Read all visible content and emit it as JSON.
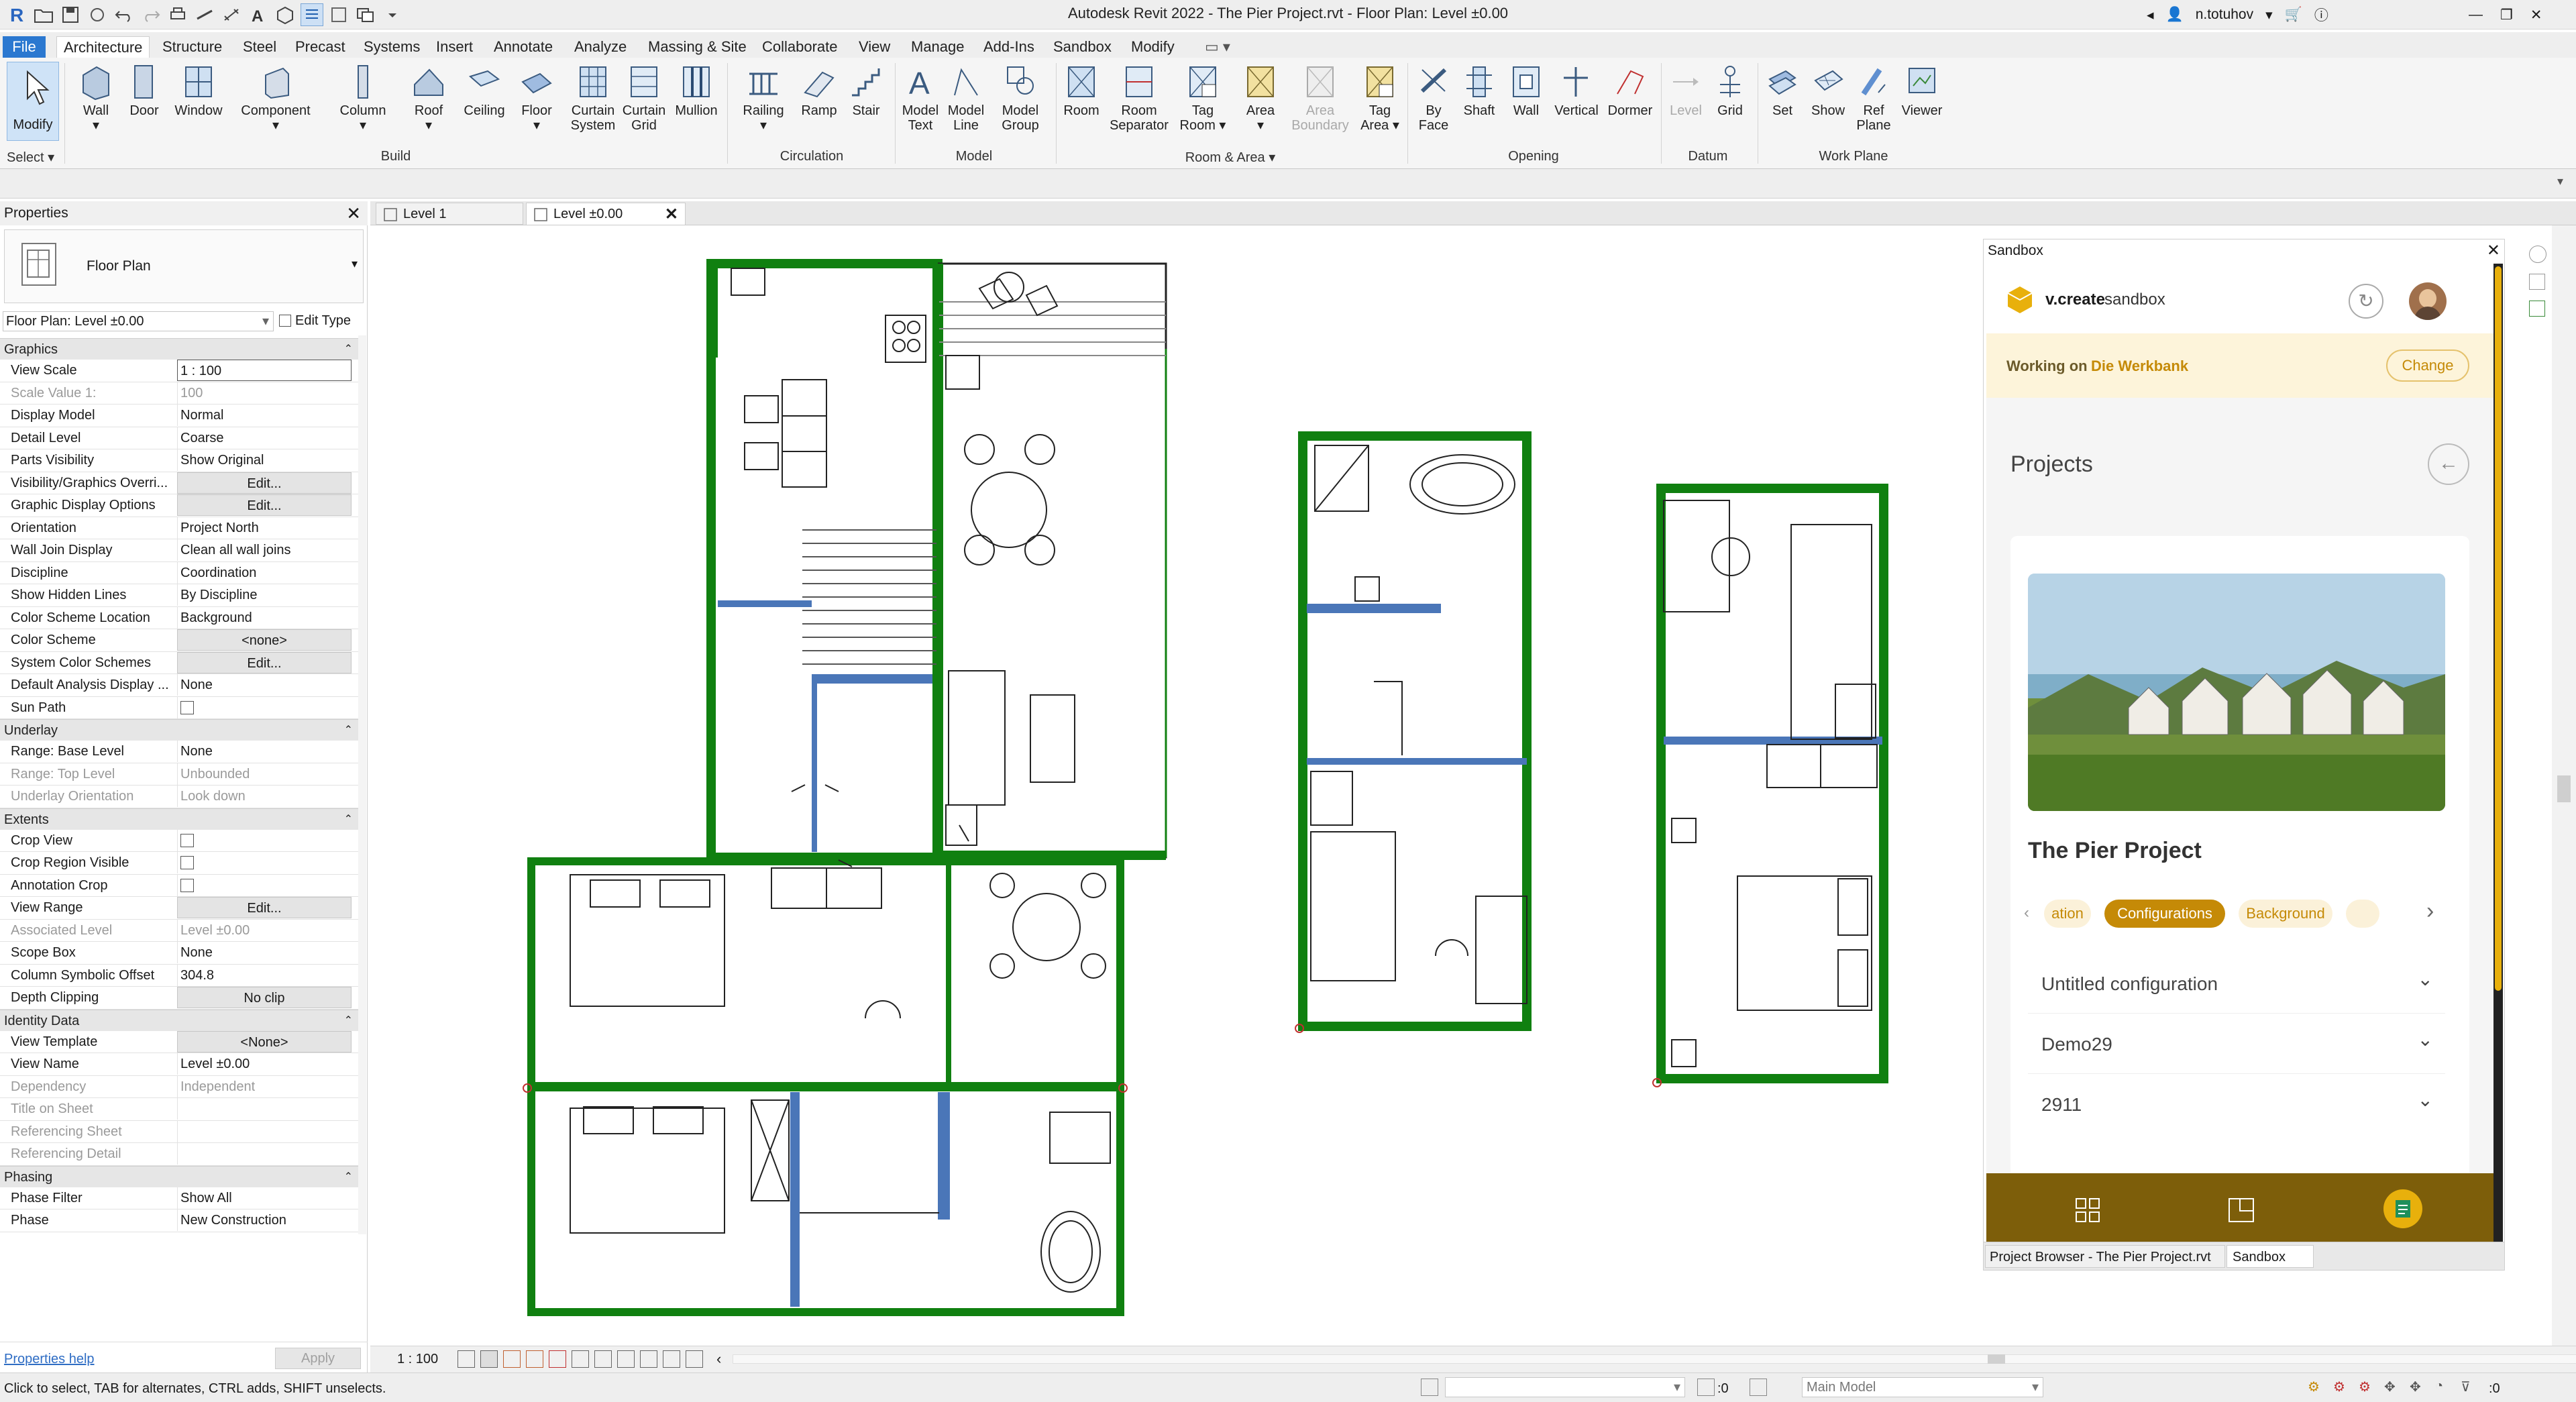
{
  "window": {
    "title": "Autodesk Revit 2022 - The Pier Project.rvt - Floor Plan: Level ±0.00",
    "user": "n.totuhov"
  },
  "menu": {
    "tabs": [
      "File",
      "Architecture",
      "Structure",
      "Steel",
      "Precast",
      "Systems",
      "Insert",
      "Annotate",
      "Analyze",
      "Massing & Site",
      "Collaborate",
      "View",
      "Manage",
      "Add-Ins",
      "Sandbox",
      "Modify"
    ],
    "active": "Architecture"
  },
  "ribbon": {
    "modify": "Modify",
    "select": "Select",
    "build": {
      "label": "Build",
      "wall": "Wall",
      "door": "Door",
      "window": "Window",
      "component": "Component",
      "column": "Column",
      "roof": "Roof",
      "ceiling": "Ceiling",
      "floor": "Floor",
      "curtain_system_1": "Curtain",
      "curtain_system_2": "System",
      "curtain_grid_1": "Curtain",
      "curtain_grid_2": "Grid",
      "mullion": "Mullion"
    },
    "circulation": {
      "label": "Circulation",
      "railing": "Railing",
      "ramp": "Ramp",
      "stair": "Stair"
    },
    "model": {
      "label": "Model",
      "model_text_1": "Model",
      "model_text_2": "Text",
      "model_line_1": "Model",
      "model_line_2": "Line",
      "model_group_1": "Model",
      "model_group_2": "Group"
    },
    "room_area": {
      "label": "Room & Area",
      "room": "Room",
      "room_sep_1": "Room",
      "room_sep_2": "Separator",
      "tag_room_1": "Tag",
      "tag_room_2": "Room",
      "area": "Area",
      "area_boundary_1": "Area",
      "area_boundary_2": "Boundary",
      "tag_area_1": "Tag",
      "tag_area_2": "Area"
    },
    "opening": {
      "label": "Opening",
      "by_face_1": "By",
      "by_face_2": "Face",
      "shaft": "Shaft",
      "wall": "Wall",
      "vertical": "Vertical",
      "dormer": "Dormer"
    },
    "datum": {
      "label": "Datum",
      "level": "Level",
      "grid": "Grid"
    },
    "work_plane": {
      "label": "Work Plane",
      "set": "Set",
      "show": "Show",
      "ref_plane_1": "Ref",
      "ref_plane_2": "Plane",
      "viewer": "Viewer"
    }
  },
  "properties": {
    "title": "Properties",
    "type_name": "Floor Plan",
    "instance": "Floor Plan: Level ±0.00",
    "edit_type": "Edit Type",
    "groups": {
      "graphics": "Graphics",
      "underlay": "Underlay",
      "extents": "Extents",
      "identity": "Identity Data",
      "phasing": "Phasing"
    },
    "rows": {
      "view_scale": {
        "k": "View Scale",
        "v": "1 : 100"
      },
      "scale_value": {
        "k": "Scale Value    1:",
        "v": "100"
      },
      "display_model": {
        "k": "Display Model",
        "v": "Normal"
      },
      "detail_level": {
        "k": "Detail Level",
        "v": "Coarse"
      },
      "parts_visibility": {
        "k": "Parts Visibility",
        "v": "Show Original"
      },
      "vg_overrides": {
        "k": "Visibility/Graphics Overri...",
        "v": "Edit..."
      },
      "graphic_display": {
        "k": "Graphic Display Options",
        "v": "Edit..."
      },
      "orientation": {
        "k": "Orientation",
        "v": "Project North"
      },
      "wall_join": {
        "k": "Wall Join Display",
        "v": "Clean all wall joins"
      },
      "discipline": {
        "k": "Discipline",
        "v": "Coordination"
      },
      "hidden_lines": {
        "k": "Show Hidden Lines",
        "v": "By Discipline"
      },
      "cs_location": {
        "k": "Color Scheme Location",
        "v": "Background"
      },
      "color_scheme": {
        "k": "Color Scheme",
        "v": "<none>"
      },
      "sys_color": {
        "k": "System Color Schemes",
        "v": "Edit..."
      },
      "analysis_display": {
        "k": "Default Analysis Display ...",
        "v": "None"
      },
      "sun_path": {
        "k": "Sun Path",
        "v": ""
      },
      "base_level": {
        "k": "Range: Base Level",
        "v": "None"
      },
      "top_level": {
        "k": "Range: Top Level",
        "v": "Unbounded"
      },
      "underlay_orient": {
        "k": "Underlay Orientation",
        "v": "Look down"
      },
      "crop_view": {
        "k": "Crop View",
        "v": ""
      },
      "crop_region": {
        "k": "Crop Region Visible",
        "v": ""
      },
      "annotation_crop": {
        "k": "Annotation Crop",
        "v": ""
      },
      "view_range": {
        "k": "View Range",
        "v": "Edit..."
      },
      "assoc_level": {
        "k": "Associated Level",
        "v": "Level ±0.00"
      },
      "scope_box": {
        "k": "Scope Box",
        "v": "None"
      },
      "col_offset": {
        "k": "Column Symbolic Offset",
        "v": "304.8"
      },
      "depth_clip": {
        "k": "Depth Clipping",
        "v": "No clip"
      },
      "view_template": {
        "k": "View Template",
        "v": "<None>"
      },
      "view_name": {
        "k": "View Name",
        "v": "Level ±0.00"
      },
      "dependency": {
        "k": "Dependency",
        "v": "Independent"
      },
      "title_sheet": {
        "k": "Title on Sheet",
        "v": ""
      },
      "ref_sheet": {
        "k": "Referencing Sheet",
        "v": ""
      },
      "ref_detail": {
        "k": "Referencing Detail",
        "v": ""
      },
      "phase_filter": {
        "k": "Phase Filter",
        "v": "Show All"
      },
      "phase": {
        "k": "Phase",
        "v": "New Construction"
      }
    },
    "help": "Properties help",
    "apply": "Apply"
  },
  "view_tabs": [
    {
      "label": "Level 1"
    },
    {
      "label": "Level ±0.00"
    }
  ],
  "sandbox": {
    "panel_title": "Sandbox",
    "brand": "v.create",
    "brand_suffix": "sandbox",
    "working_on": "Working on",
    "workspace": "Die Werkbank",
    "change": "Change",
    "projects_title": "Projects",
    "project_name": "The Pier Project",
    "chips": [
      "ation",
      "Configurations",
      "Background"
    ],
    "configs": [
      "Untitled configuration",
      "Demo29",
      "2911"
    ],
    "accent": "#c58a07",
    "footer_color": "#7d5e0a"
  },
  "panel_tabs": [
    "Project Browser - The Pier Project.rvt",
    "Sandbox"
  ],
  "view_bar": {
    "scale": "1 : 100"
  },
  "status": {
    "message": "Click to select, TAB for alternates, CTRL adds, SHIFT unselects.",
    "coord": ":0",
    "workset": "Main Model"
  }
}
